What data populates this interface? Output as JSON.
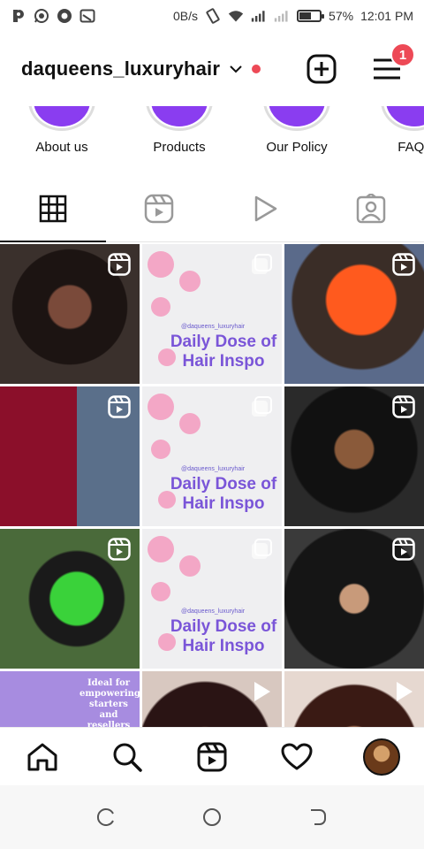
{
  "status_bar": {
    "left_icons": [
      "p-icon",
      "whatsapp-icon",
      "chrome-icon",
      "cast-icon"
    ],
    "data_speed": "0B/s",
    "battery": "57%",
    "battery_level": 0.57,
    "time": "12:01 PM"
  },
  "header": {
    "username": "daqueens_luxuryhair",
    "notification_count": "1"
  },
  "highlights": [
    {
      "label": "About us"
    },
    {
      "label": "Products"
    },
    {
      "label": "Our Policy"
    },
    {
      "label": "FAQs"
    }
  ],
  "tabs": [
    "grid",
    "reels",
    "videos",
    "tagged"
  ],
  "grid": {
    "inspo_handle": "@daqueens_luxuryhair",
    "inspo_title": "Daily Dose of Hair Inspo",
    "promo_text": "Ideal for empowering starters and resellers"
  },
  "bottom_nav": [
    "home",
    "search",
    "reels",
    "activity",
    "profile"
  ],
  "colors": {
    "accent_red": "#ed4956",
    "highlight_purple": "#8a3df0",
    "inspo_purple": "#7a55d8"
  }
}
